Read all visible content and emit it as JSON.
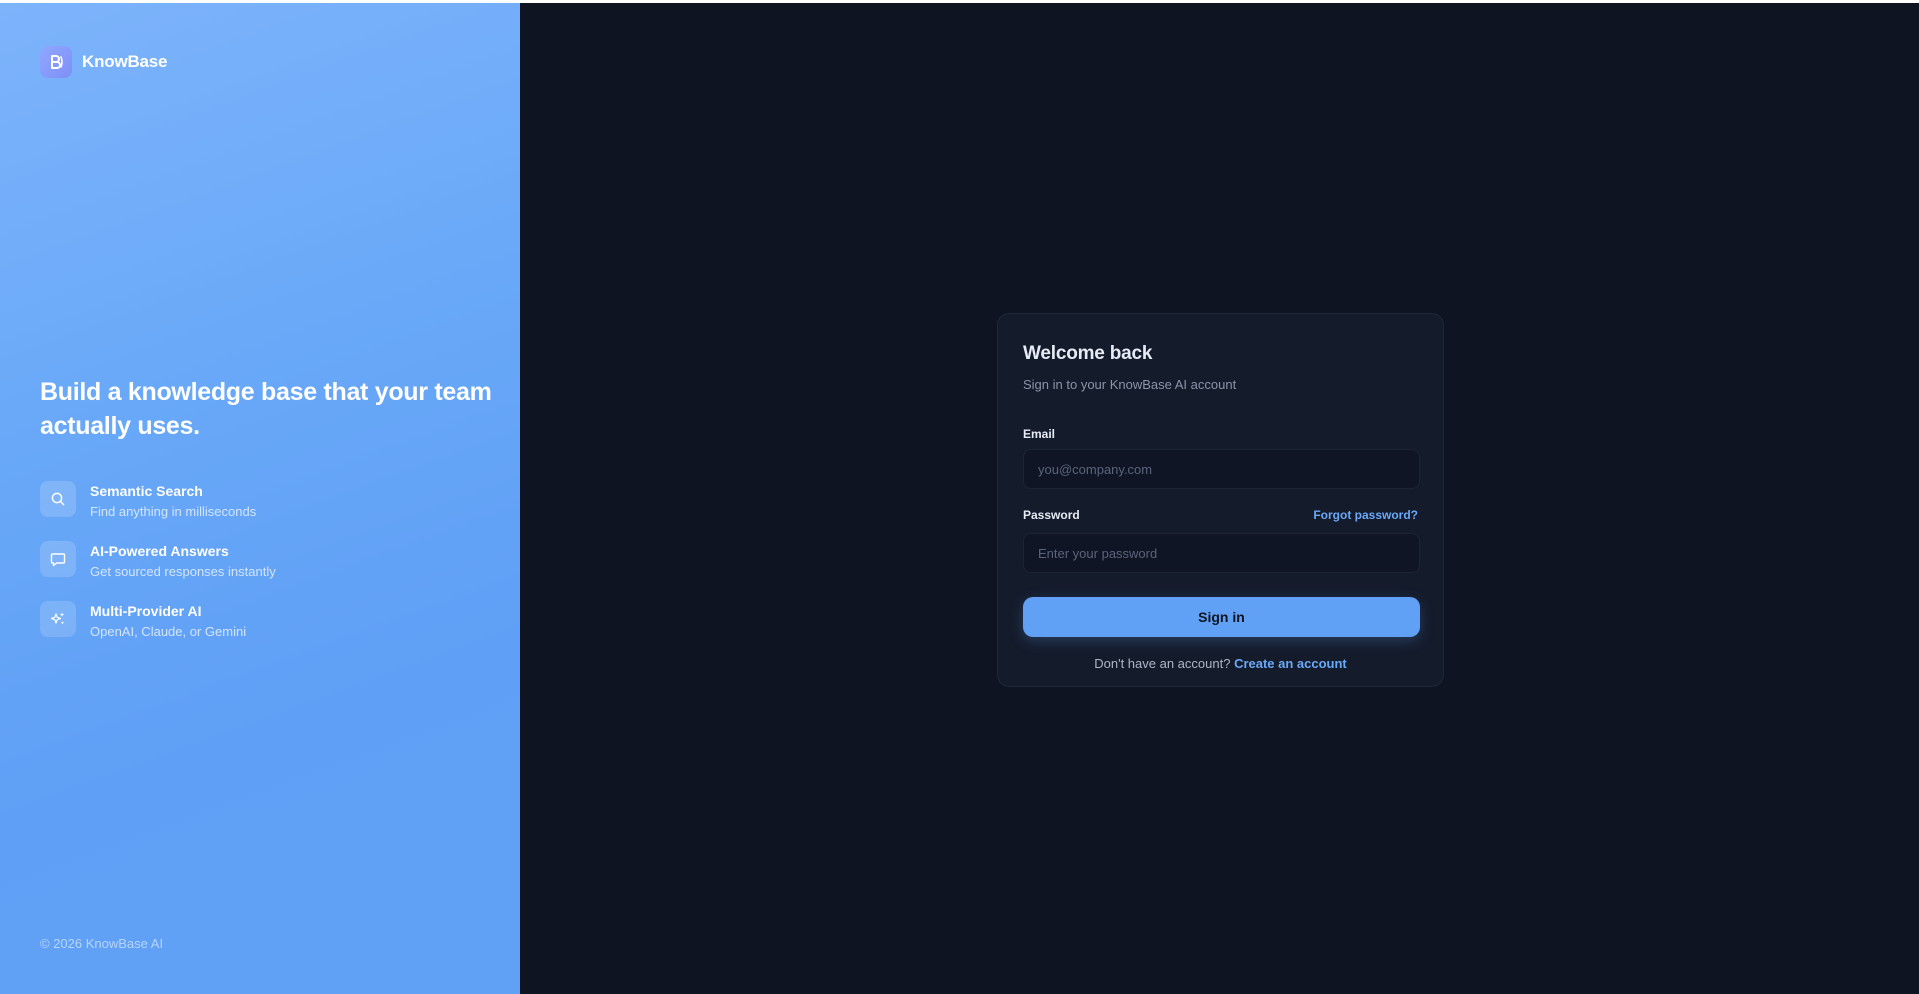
{
  "brand": {
    "name": "KnowBase"
  },
  "hero": {
    "headline": "Build a knowledge base that your team actually uses.",
    "features": [
      {
        "icon": "search-icon",
        "title": "Semantic Search",
        "description": "Find anything in milliseconds"
      },
      {
        "icon": "chat-bubble-icon",
        "title": "AI-Powered Answers",
        "description": "Get sourced responses instantly"
      },
      {
        "icon": "sparkles-icon",
        "title": "Multi-Provider AI",
        "description": "OpenAI, Claude, or Gemini"
      }
    ],
    "copyright": "© 2026 KnowBase AI"
  },
  "login": {
    "title": "Welcome back",
    "subtitle": "Sign in to your KnowBase AI account",
    "email_label": "Email",
    "email_placeholder": "you@company.com",
    "password_label": "Password",
    "forgot_label": "Forgot password?",
    "password_placeholder": "Enter your password",
    "signin_label": "Sign in",
    "signup_prompt": "Don't have an account?",
    "signup_link": "Create an account"
  },
  "colors": {
    "accent": "#61a1f5",
    "background": "#0e1422",
    "card": "#141b2b"
  }
}
